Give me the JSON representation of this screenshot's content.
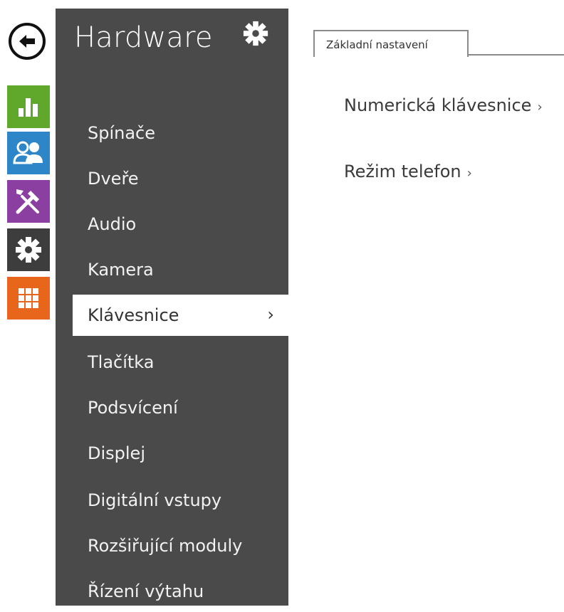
{
  "rail": {
    "items": [
      {
        "icon": "back-arrow-icon"
      },
      {
        "icon": "status-chart-icon",
        "color": "#5fa82c"
      },
      {
        "icon": "users-icon",
        "color": "#2e86c8"
      },
      {
        "icon": "tools-icon",
        "color": "#8b3fa0"
      },
      {
        "icon": "gear-icon",
        "color": "#3d3d3d"
      },
      {
        "icon": "grid-icon",
        "color": "#e8661b"
      }
    ]
  },
  "menu": {
    "title": "Hardware",
    "background": "#4a4a4a",
    "items": [
      {
        "label": "Spínače"
      },
      {
        "label": "Dveře"
      },
      {
        "label": "Audio"
      },
      {
        "label": "Kamera"
      },
      {
        "label": "Klávesnice",
        "chevron": "›",
        "active": true
      },
      {
        "label": "Tlačítka"
      },
      {
        "label": "Podsvícení"
      },
      {
        "label": "Displej"
      },
      {
        "label": "Digitální vstupy"
      },
      {
        "label": "Rozšiřující moduly"
      },
      {
        "label": "Řízení výtahu"
      }
    ]
  },
  "tabs": [
    {
      "label": "Základní nastavení",
      "active": true
    }
  ],
  "content": {
    "links": [
      {
        "label": "Numerická klávesnice",
        "arrow": "›"
      },
      {
        "label": "Režim telefon",
        "arrow": "›"
      }
    ]
  }
}
